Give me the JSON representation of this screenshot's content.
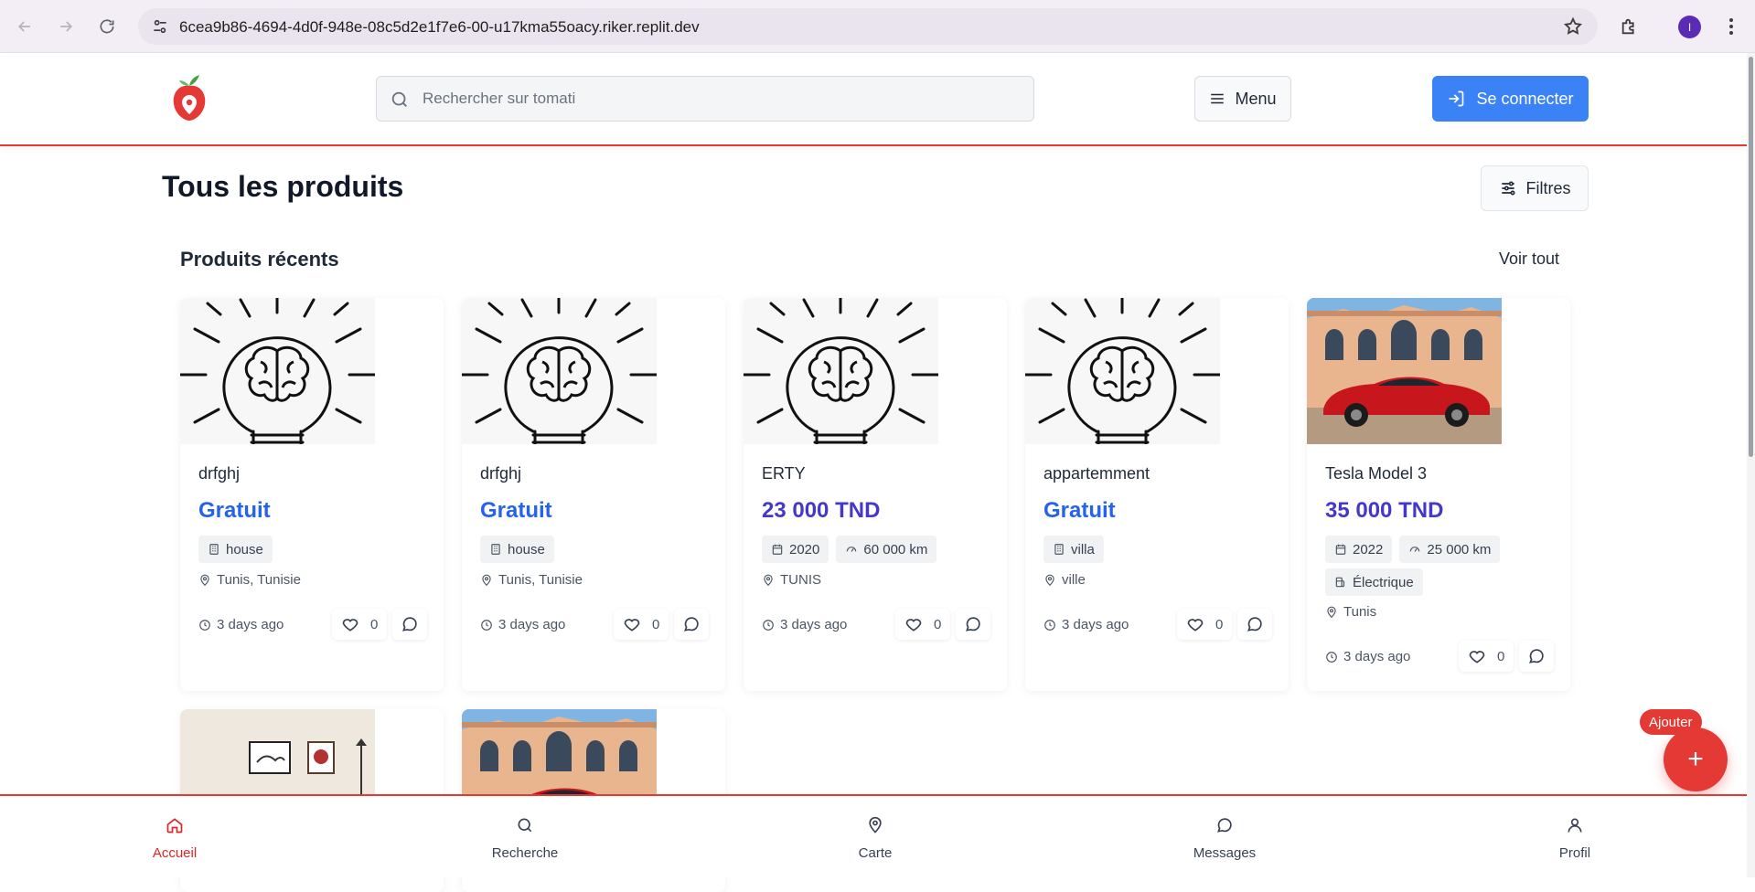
{
  "browser": {
    "url": "6cea9b86-4694-4d0f-948e-08c5d2e1f7e6-00-u17kma55oacy.riker.replit.dev",
    "avatar_initial": "I"
  },
  "header": {
    "search_placeholder": "Rechercher sur tomati",
    "menu_label": "Menu",
    "login_label": "Se connecter"
  },
  "page": {
    "title": "Tous les produits",
    "filters_label": "Filtres",
    "section_title": "Produits récents",
    "see_all_label": "Voir tout"
  },
  "products": [
    {
      "title": "drfghj",
      "price": "Gratuit",
      "tags": [
        "house"
      ],
      "location": "Tunis, Tunisie",
      "time": "3 days ago",
      "likes": "0",
      "image": "lightbulb-brain"
    },
    {
      "title": "drfghj",
      "price": "Gratuit",
      "tags": [
        "house"
      ],
      "location": "Tunis, Tunisie",
      "time": "3 days ago",
      "likes": "0",
      "image": "lightbulb-brain"
    },
    {
      "title": "ERTY",
      "price": "23 000 TND",
      "tags": [
        "2020",
        "60 000 km"
      ],
      "location": "TUNIS",
      "time": "3 days ago",
      "likes": "0",
      "image": "lightbulb-brain"
    },
    {
      "title": "appartemment",
      "price": "Gratuit",
      "tags": [
        "villa"
      ],
      "location": "ville",
      "time": "3 days ago",
      "likes": "0",
      "image": "lightbulb-brain"
    },
    {
      "title": "Tesla Model 3",
      "price": "35 000 TND",
      "tags": [
        "2022",
        "25 000 km",
        "Électrique"
      ],
      "location": "Tunis",
      "time": "3 days ago",
      "likes": "0",
      "image": "red-car"
    }
  ],
  "fab": {
    "label": "Ajouter",
    "icon": "+"
  },
  "bottom_nav": [
    {
      "label": "Accueil",
      "icon": "home-icon",
      "active": true
    },
    {
      "label": "Recherche",
      "icon": "search-icon"
    },
    {
      "label": "Carte",
      "icon": "map-pin-icon"
    },
    {
      "label": "Messages",
      "icon": "message-icon"
    },
    {
      "label": "Profil",
      "icon": "user-icon"
    }
  ],
  "colors": {
    "accent": "#e53935",
    "primary": "#3b82f6",
    "price_free": "#2563eb",
    "price_tnd": "#4338ca"
  }
}
